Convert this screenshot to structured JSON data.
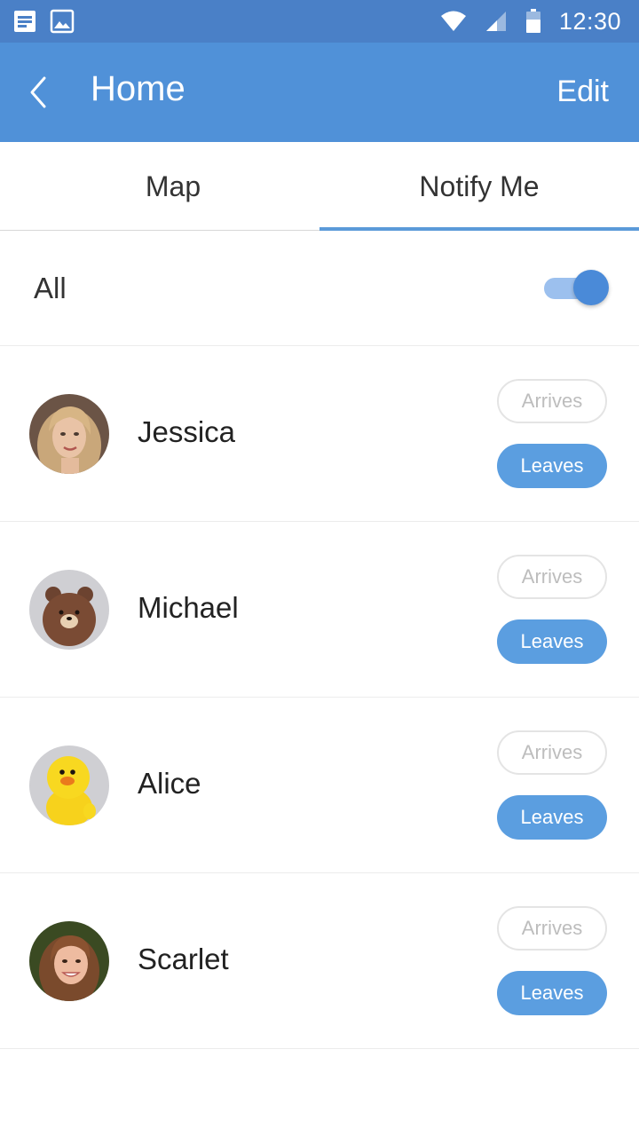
{
  "status_bar": {
    "time": "12:30",
    "left_icons": [
      "notification-doc-icon",
      "image-icon"
    ],
    "right_icons": [
      "wifi-icon",
      "signal-icon",
      "battery-icon"
    ]
  },
  "app_bar": {
    "back_icon": "chevron-left-icon",
    "title": "Home",
    "edit_label": "Edit",
    "color": "#5091d8"
  },
  "tabs": [
    {
      "label": "Map",
      "active": false
    },
    {
      "label": "Notify Me",
      "active": true
    }
  ],
  "all_toggle": {
    "label": "All",
    "on": true
  },
  "people": [
    {
      "name": "Jessica",
      "avatar": "photo-woman-blonde",
      "arrives_label": "Arrives",
      "arrives_selected": false,
      "leaves_label": "Leaves",
      "leaves_selected": true
    },
    {
      "name": "Michael",
      "avatar": "brown-bear-character",
      "arrives_label": "Arrives",
      "arrives_selected": false,
      "leaves_label": "Leaves",
      "leaves_selected": true
    },
    {
      "name": "Alice",
      "avatar": "yellow-chick-character",
      "arrives_label": "Arrives",
      "arrives_selected": false,
      "leaves_label": "Leaves",
      "leaves_selected": true
    },
    {
      "name": "Scarlet",
      "avatar": "photo-woman-brunette",
      "arrives_label": "Arrives",
      "arrives_selected": false,
      "leaves_label": "Leaves",
      "leaves_selected": true
    }
  ],
  "colors": {
    "accent": "#5b9ee0",
    "status_bar": "#4a80c7",
    "inactive_border": "#e4e4e4"
  }
}
